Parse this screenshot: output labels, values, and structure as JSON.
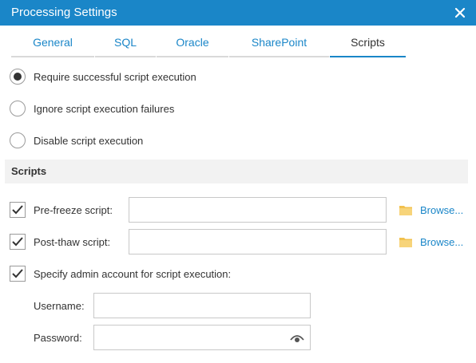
{
  "dialog": {
    "title": "Processing Settings",
    "accent_color": "#1a86c8"
  },
  "tabs": [
    {
      "label": "General",
      "active": false
    },
    {
      "label": "SQL",
      "active": false
    },
    {
      "label": "Oracle",
      "active": false
    },
    {
      "label": "SharePoint",
      "active": false
    },
    {
      "label": "Scripts",
      "active": true
    }
  ],
  "options": [
    {
      "label": "Require successful script execution",
      "checked": true
    },
    {
      "label": "Ignore script execution failures",
      "checked": false
    },
    {
      "label": "Disable script execution",
      "checked": false
    }
  ],
  "scripts_section": {
    "header": "Scripts",
    "pre_freeze": {
      "label": "Pre-freeze script:",
      "checked": true,
      "value": "",
      "browse_label": "Browse..."
    },
    "post_thaw": {
      "label": "Post-thaw script:",
      "checked": true,
      "value": "",
      "browse_label": "Browse..."
    },
    "admin": {
      "label": "Specify admin account for script execution:",
      "checked": true
    },
    "username": {
      "label": "Username:",
      "value": ""
    },
    "password": {
      "label": "Password:",
      "value": ""
    }
  },
  "icons": {
    "close": "close-icon",
    "folder": "folder-icon",
    "eye": "eye-icon",
    "check": "checkmark-icon"
  }
}
